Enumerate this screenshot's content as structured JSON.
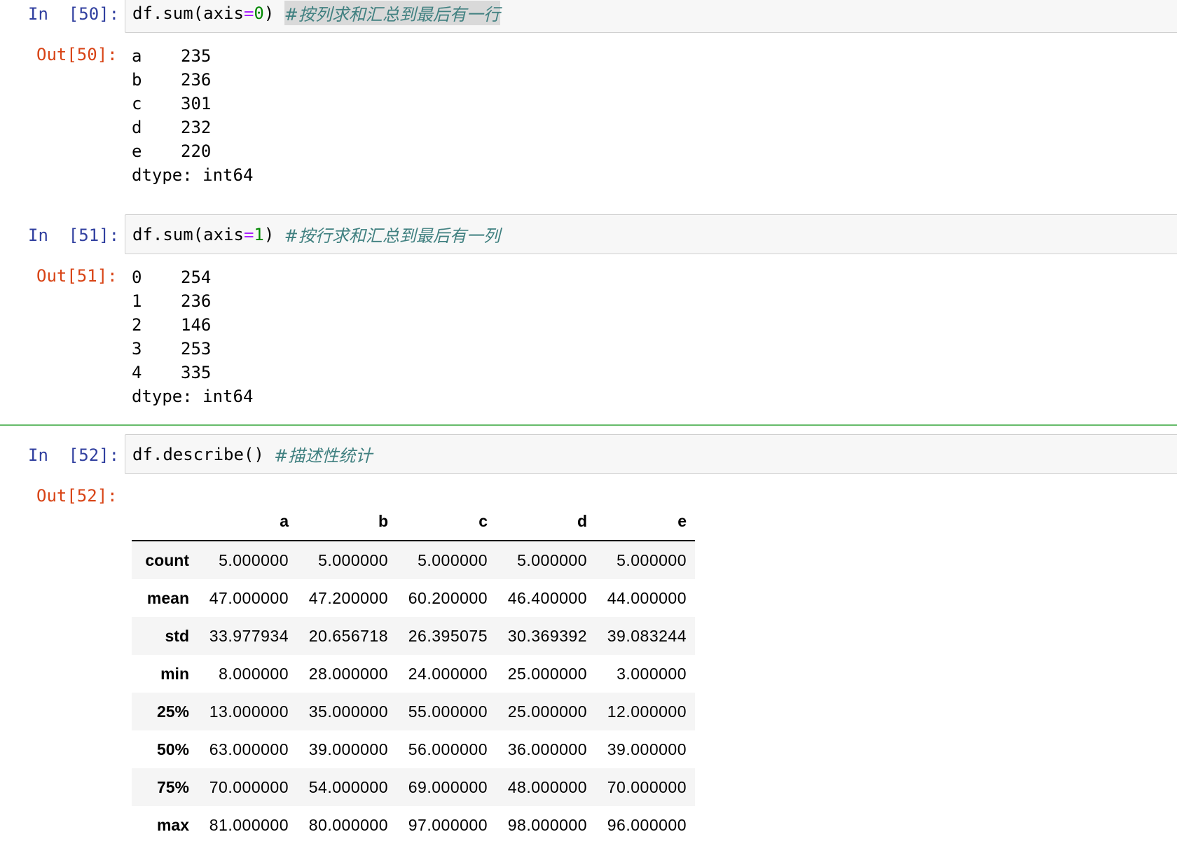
{
  "cells": [
    {
      "in_prompt": "In  [50]:",
      "code": "df.sum(axis=0)",
      "code_parts": [
        "df.sum(axis",
        "=",
        "0",
        ") "
      ],
      "comment": "#按列求和汇总到最后有一行",
      "out_prompt": "Out[50]:",
      "series": [
        {
          "index": "a",
          "value": "235"
        },
        {
          "index": "b",
          "value": "236"
        },
        {
          "index": "c",
          "value": "301"
        },
        {
          "index": "d",
          "value": "232"
        },
        {
          "index": "e",
          "value": "220"
        }
      ],
      "dtype": "dtype: int64"
    },
    {
      "in_prompt": "In  [51]:",
      "code_parts": [
        "df.sum(axis",
        "=",
        "1",
        ") "
      ],
      "comment": "#按行求和汇总到最后有一列",
      "out_prompt": "Out[51]:",
      "series": [
        {
          "index": "0",
          "value": "254"
        },
        {
          "index": "1",
          "value": "236"
        },
        {
          "index": "2",
          "value": "146"
        },
        {
          "index": "3",
          "value": "253"
        },
        {
          "index": "4",
          "value": "335"
        }
      ],
      "dtype": "dtype: int64"
    },
    {
      "in_prompt": "In  [52]:",
      "code": "df.describe() ",
      "comment": "#描述性统计",
      "out_prompt": "Out[52]:",
      "table": {
        "columns": [
          "a",
          "b",
          "c",
          "d",
          "e"
        ],
        "rows": [
          {
            "label": "count",
            "values": [
              "5.000000",
              "5.000000",
              "5.000000",
              "5.000000",
              "5.000000"
            ]
          },
          {
            "label": "mean",
            "values": [
              "47.000000",
              "47.200000",
              "60.200000",
              "46.400000",
              "44.000000"
            ]
          },
          {
            "label": "std",
            "values": [
              "33.977934",
              "20.656718",
              "26.395075",
              "30.369392",
              "39.083244"
            ]
          },
          {
            "label": "min",
            "values": [
              "8.000000",
              "28.000000",
              "24.000000",
              "25.000000",
              "3.000000"
            ]
          },
          {
            "label": "25%",
            "values": [
              "13.000000",
              "35.000000",
              "55.000000",
              "25.000000",
              "12.000000"
            ]
          },
          {
            "label": "50%",
            "values": [
              "63.000000",
              "39.000000",
              "56.000000",
              "36.000000",
              "39.000000"
            ]
          },
          {
            "label": "75%",
            "values": [
              "70.000000",
              "54.000000",
              "69.000000",
              "48.000000",
              "70.000000"
            ]
          },
          {
            "label": "max",
            "values": [
              "81.000000",
              "80.000000",
              "97.000000",
              "98.000000",
              "96.000000"
            ]
          }
        ]
      }
    }
  ]
}
